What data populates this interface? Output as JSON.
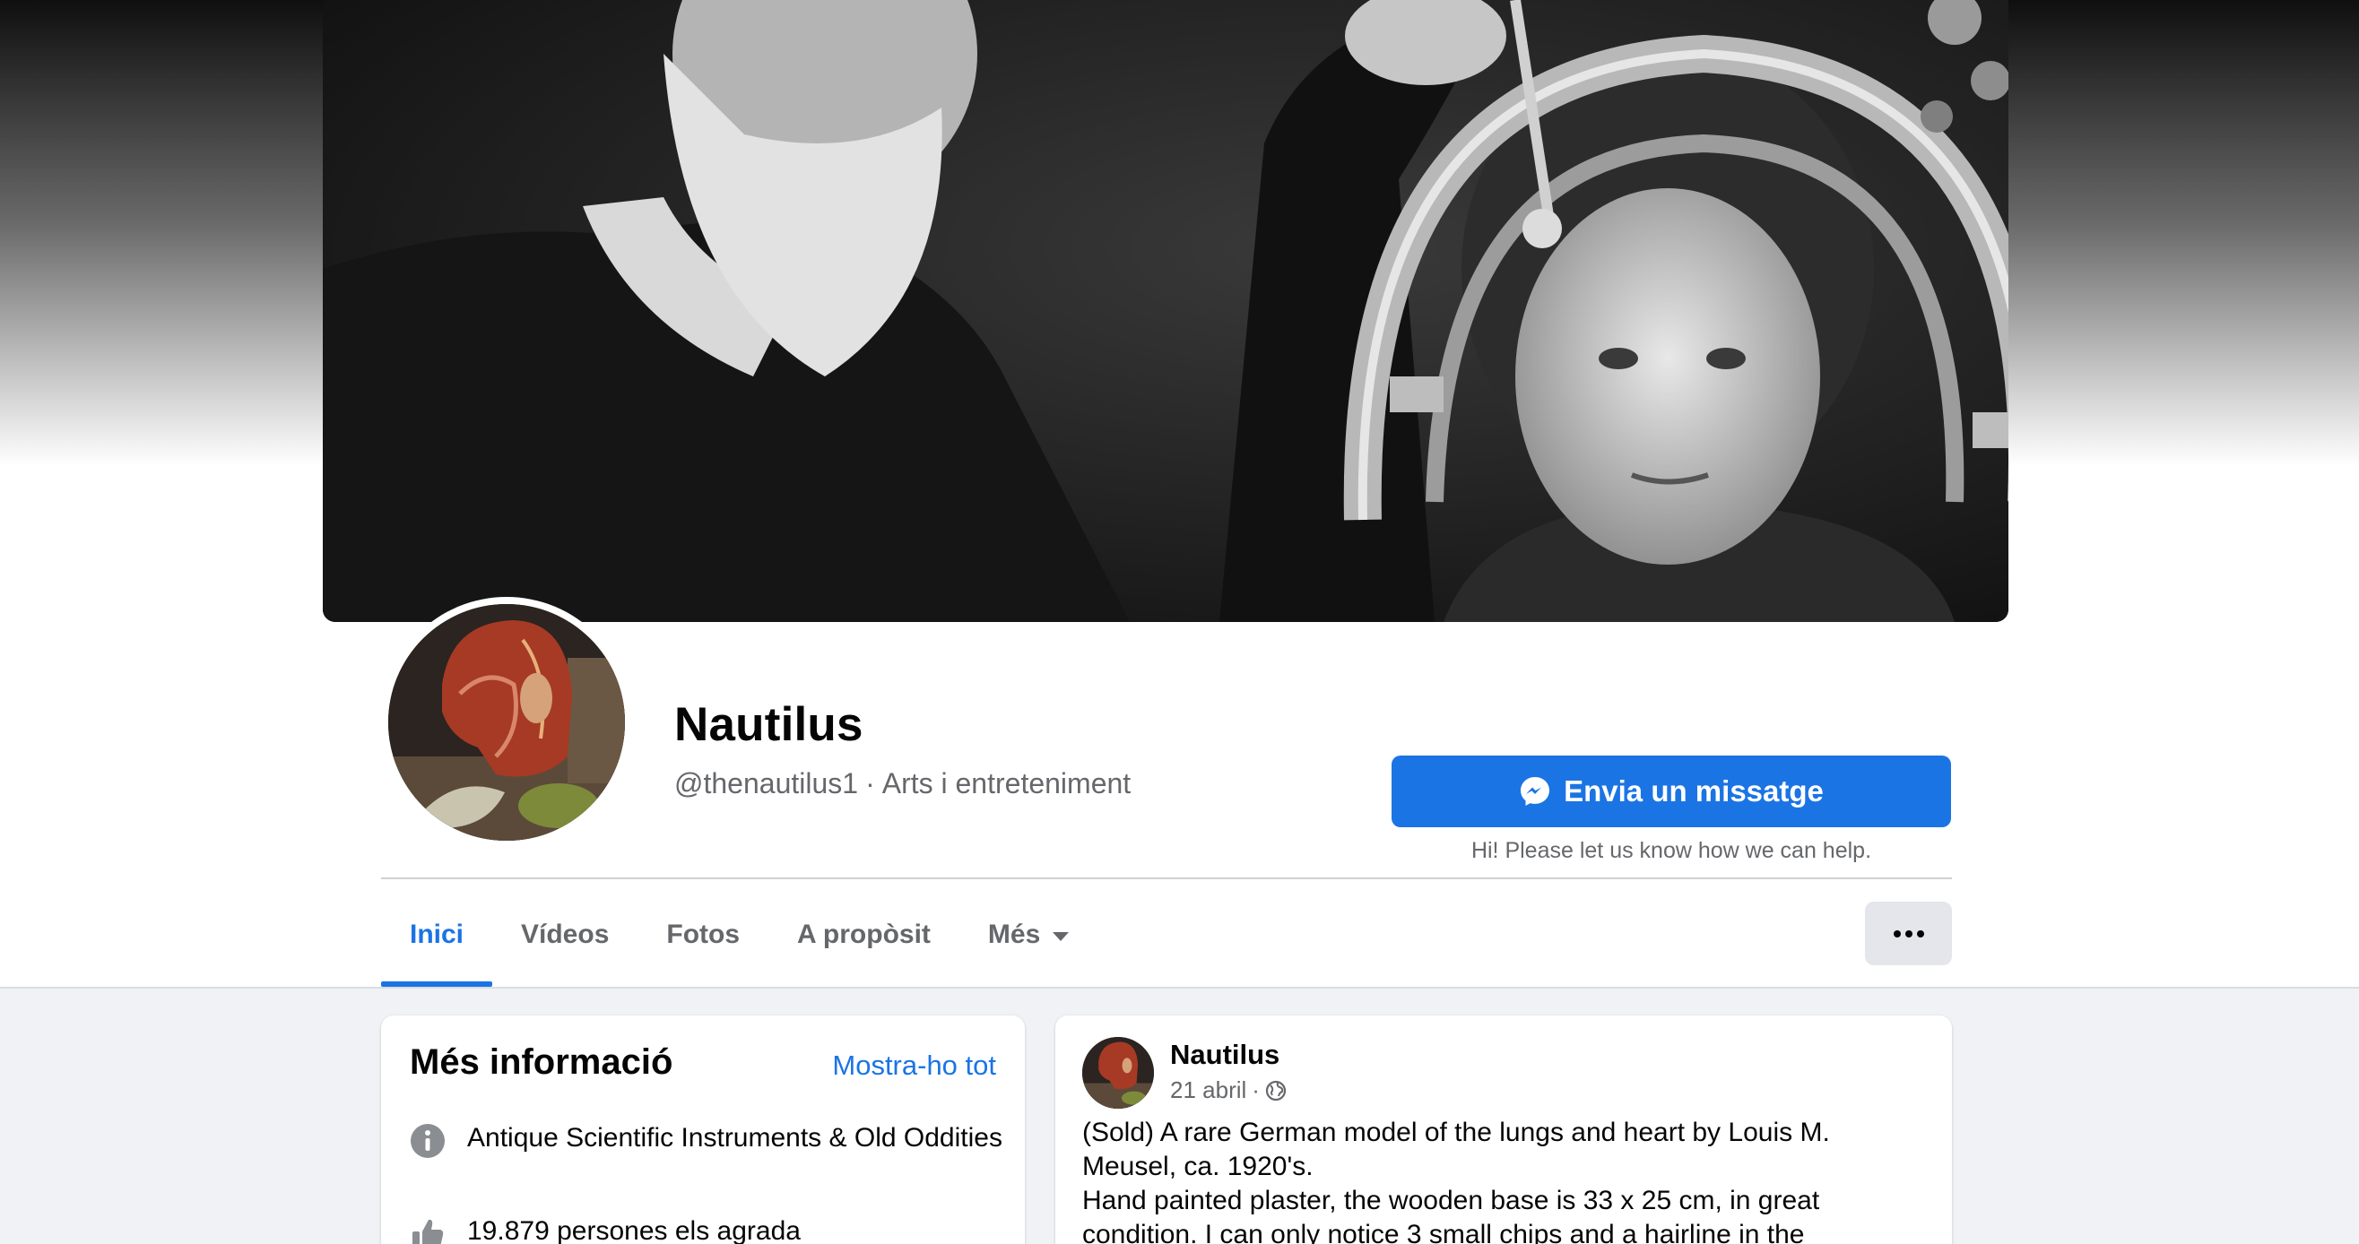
{
  "page": {
    "name": "Nautilus",
    "handle": "@thenautilus1",
    "separator": "·",
    "category": "Arts i entreteniment"
  },
  "actions": {
    "message_label": "Envia un missatge",
    "message_hint": "Hi! Please let us know how we can help.",
    "more_icon": "ellipsis-icon"
  },
  "tabs": [
    {
      "label": "Inici",
      "active": true
    },
    {
      "label": "Vídeos",
      "active": false
    },
    {
      "label": "Fotos",
      "active": false
    },
    {
      "label": "A propòsit",
      "active": false
    },
    {
      "label": "Més",
      "active": false,
      "dropdown": true
    }
  ],
  "info_card": {
    "title": "Més informació",
    "see_all": "Mostra-ho tot",
    "rows": [
      {
        "icon": "info-icon",
        "text": "Antique Scientific Instruments & Old Oddities"
      },
      {
        "icon": "thumbs-up-icon",
        "text": "19.879 persones els agrada"
      }
    ]
  },
  "post": {
    "author": "Nautilus",
    "date": "21 abril",
    "meta_separator": "·",
    "audience_icon": "globe-icon",
    "lines": [
      "(Sold) A rare German model of the lungs and heart by Louis M. Meusel, ca. 1920's.",
      "Hand painted plaster, the wooden base is 33 x 25 cm, in great condition. I can only notice 3 small chips and a hairline in the"
    ]
  },
  "colors": {
    "accent": "#1b74e4",
    "secondary_text": "#65676b",
    "background": "#f0f2f5"
  }
}
